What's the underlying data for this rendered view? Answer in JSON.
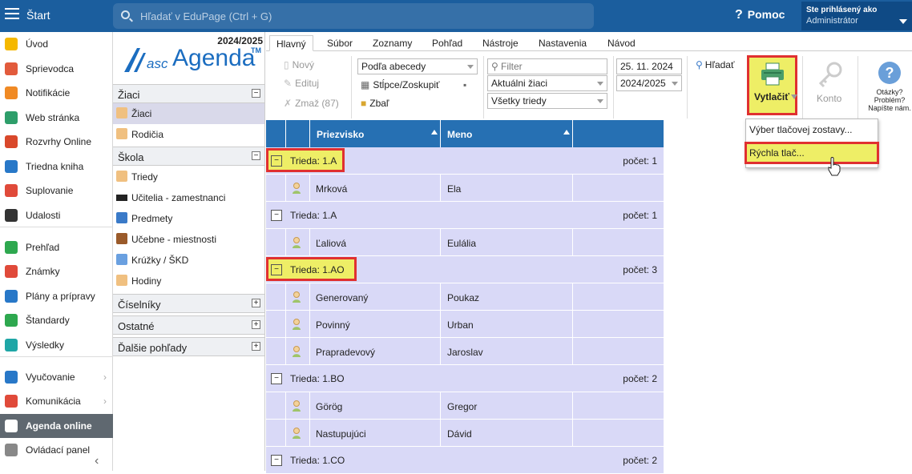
{
  "topbar": {
    "start": "Štart",
    "search_placeholder": "Hľadať v EduPage (Ctrl + G)",
    "help_q": "?",
    "help": "Pomoc",
    "user_line1": "Ste prihlásený ako",
    "user_line2": "Administrátor"
  },
  "nav": {
    "items": [
      {
        "label": "Úvod",
        "icon": "star-icon",
        "color": "#f5b800"
      },
      {
        "label": "Sprievodca",
        "icon": "wand-icon",
        "color": "#e25b3c"
      },
      {
        "label": "Notifikácie",
        "icon": "envelope-icon",
        "color": "#f08a24"
      },
      {
        "label": "Web stránka",
        "icon": "home-icon",
        "color": "#2e9e6a"
      },
      {
        "label": "Rozvrhy Online",
        "icon": "timetable-icon",
        "color": "#d9482b"
      },
      {
        "label": "Triedna kniha",
        "icon": "book-icon",
        "color": "#2878c8"
      },
      {
        "label": "Suplovanie",
        "icon": "substitute-icon",
        "color": "#e04a3a"
      },
      {
        "label": "Udalosti",
        "icon": "calendar-icon",
        "color": "#333333"
      },
      {
        "label": "Prehľad",
        "icon": "check-circle-icon",
        "color": "#2ea84f"
      },
      {
        "label": "Známky",
        "icon": "grades-icon",
        "color": "#e04a3a"
      },
      {
        "label": "Plány a prípravy",
        "icon": "briefcase-icon",
        "color": "#2878c8"
      },
      {
        "label": "Štandardy",
        "icon": "shield-icon",
        "color": "#2ea84f"
      },
      {
        "label": "Výsledky",
        "icon": "bars-icon",
        "color": "#1fa6a6"
      },
      {
        "label": "Vyučovanie",
        "icon": "board-icon",
        "color": "#2878c8",
        "chev": "›"
      },
      {
        "label": "Komunikácia",
        "icon": "chat-icon",
        "color": "#e04a3a",
        "chev": "›"
      },
      {
        "label": "Agenda online",
        "icon": "agenda-icon",
        "color": "#ffffff"
      },
      {
        "label": "Ovládací panel",
        "icon": "gear-icon",
        "color": "#888888"
      }
    ],
    "collapse": "‹"
  },
  "panel": {
    "year": "2024/2025",
    "logo_asc": "asc",
    "logo_agenda": "Agenda",
    "logo_tm": "TM",
    "sections": [
      {
        "label": "Žiaci",
        "toggle": "−"
      },
      {
        "label": "Škola",
        "toggle": "−"
      },
      {
        "label": "Číselníky",
        "toggle": "+"
      },
      {
        "label": "Ostatné",
        "toggle": "+"
      },
      {
        "label": "Ďalšie pohľady",
        "toggle": "+"
      }
    ],
    "items": [
      {
        "label": "Žiaci"
      },
      {
        "label": "Rodičia"
      },
      {
        "label": "Triedy"
      },
      {
        "label": "Učitelia - zamestnanci"
      },
      {
        "label": "Predmety"
      },
      {
        "label": "Učebne - miestnosti"
      },
      {
        "label": "Krúžky / ŠKD"
      },
      {
        "label": "Hodiny"
      }
    ]
  },
  "ribbon": {
    "tabs": [
      "Hlavný",
      "Súbor",
      "Zoznamy",
      "Pohľad",
      "Nástroje",
      "Nastavenia",
      "Návod"
    ],
    "new": "Nový",
    "edit": "Edituj",
    "delete": "Zmaž (87)",
    "sort": "Podľa abecedy",
    "columns": "Stĺpce/Zoskupiť",
    "collapse": "Zbaľ",
    "filter_placeholder": "Filter",
    "students_filter": "Aktuálni žiaci",
    "class_filter": "Všetky triedy",
    "date": "25. 11. 2024",
    "school_year": "2024/2025",
    "search": "Hľadať",
    "print": "Vytlačiť",
    "account": "Konto",
    "help_text": "Otázky? Problém? Napíšte nám."
  },
  "print_menu": {
    "item1": "Výber tlačovej zostavy...",
    "item2": "Rýchla tlač..."
  },
  "grid": {
    "headers": [
      "Priezvisko",
      "Meno"
    ],
    "groups": [
      {
        "label": "Trieda: 1.A",
        "count": "počet: 1",
        "toggle": "−",
        "rows": [
          {
            "last": "Mrková",
            "first": "Ela"
          }
        ]
      },
      {
        "label": "Trieda: 1.A",
        "count": "počet: 1",
        "toggle": "−",
        "rows": [
          {
            "last": "Ľaliová",
            "first": "Eulália"
          }
        ]
      },
      {
        "label": "Trieda: 1.AO",
        "count": "počet: 3",
        "toggle": "−",
        "rows": [
          {
            "last": "Generovaný",
            "first": "Poukaz"
          },
          {
            "last": "Povinný",
            "first": "Urban"
          },
          {
            "last": "Prapradevový",
            "first": "Jaroslav"
          }
        ]
      },
      {
        "label": "Trieda: 1.BO",
        "count": "počet: 2",
        "toggle": "−",
        "rows": [
          {
            "last": "Görög",
            "first": "Gregor"
          },
          {
            "last": "Nastupujúci",
            "first": "Dávid"
          }
        ]
      },
      {
        "label": "Trieda: 1.CO",
        "count": "počet: 2",
        "toggle": "−",
        "rows": []
      }
    ]
  }
}
